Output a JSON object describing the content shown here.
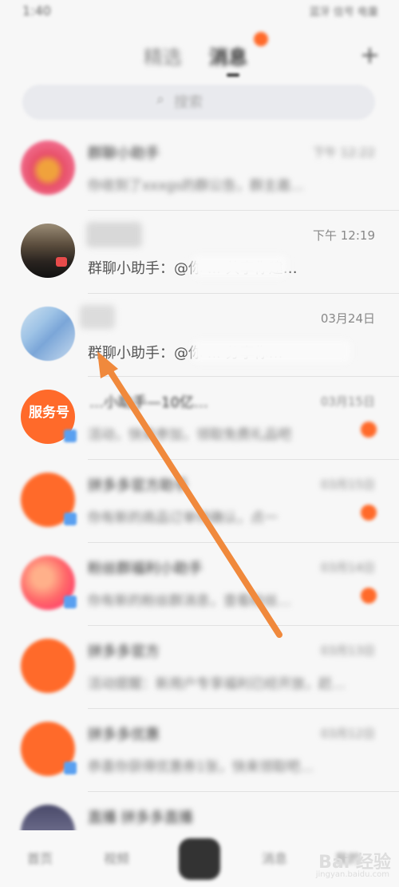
{
  "statusbar": {
    "time": "1:40",
    "indicators": "蓝牙 信号 电量"
  },
  "header": {
    "tab_select": "精选",
    "tab_message": "消息",
    "plus": "+"
  },
  "search": {
    "placeholder": "搜索",
    "icon": "search-icon"
  },
  "rows": [
    {
      "title": "群聊小助手",
      "time": "下午 12:22",
      "preview": "你收到了xxxgs的群公告，群主邀…"
    },
    {
      "title": "",
      "time": "下午 12:19",
      "preview": "群聊小助手：@你 ... 共享你建…"
    },
    {
      "title": "",
      "time": "03月24日",
      "preview": "群聊小助手：@你 ... 分享你…"
    },
    {
      "title": "…小助手—10亿…",
      "time": "03月15日",
      "preview": "活动，快来参加，领取免费礼品吧",
      "tag": "服务号"
    },
    {
      "title": "拼多多官方助手",
      "time": "03月15日",
      "preview": "你有新的商品订单待确认，点一",
      "tag": ""
    },
    {
      "title": "粉丝群福利小助手",
      "time": "03月14日",
      "preview": "你有新的粉丝群消息，查看粉丝…"
    },
    {
      "title": "拼多多官方",
      "time": "03月13日",
      "preview": "活动提醒：新用户专享福利已经开放，赶…"
    },
    {
      "title": "拼多多优惠",
      "time": "03月12日",
      "preview": "恭喜你获得优惠券1张，快来领取吧…"
    },
    {
      "title": "直播 拼多多直播",
      "time": "",
      "preview": ""
    }
  ],
  "nav": {
    "home": "首页",
    "video": "视频",
    "messages": "消息",
    "me": "我的"
  },
  "watermark": {
    "main": "Bai 经验",
    "sub": "jingyan.baidu.com"
  },
  "colors": {
    "accent": "#ff6a2a",
    "arrow": "#f0893c"
  }
}
